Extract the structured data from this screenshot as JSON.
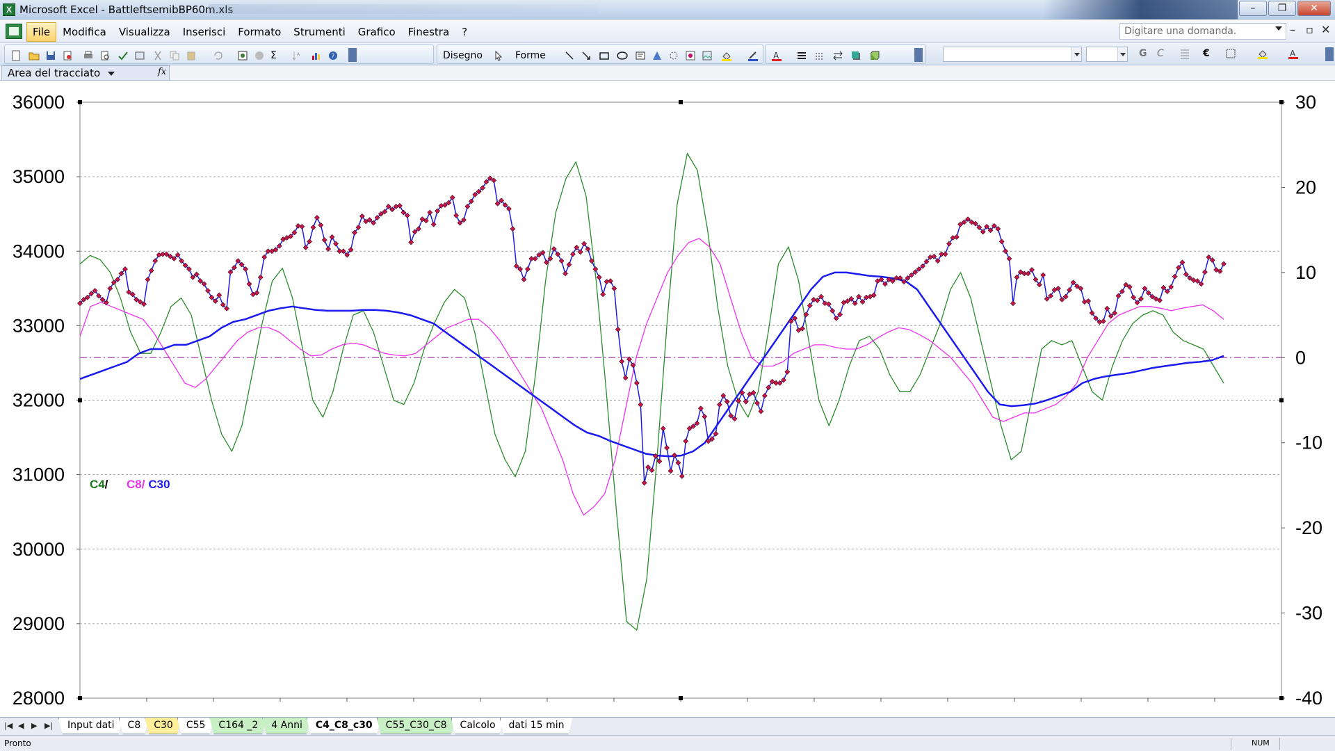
{
  "window": {
    "title": "Microsoft Excel - BattleftsemibBP60m.xls",
    "app_icon": "X"
  },
  "menu": {
    "items": [
      "File",
      "Modifica",
      "Visualizza",
      "Inserisci",
      "Formato",
      "Strumenti",
      "Grafico",
      "Finestra",
      "?"
    ],
    "active_index": 0,
    "question_placeholder": "Digitare una domanda."
  },
  "toolbar": {
    "drawing_label": "Disegno",
    "shapes_label": "Forme",
    "bold_label": "G",
    "italic_label": "C",
    "currency_label": "€",
    "sigma_label": "Σ"
  },
  "namebox": {
    "value": "Area del tracciato",
    "fx": "fx"
  },
  "chart_data": {
    "type": "line",
    "legend_text": [
      "C4",
      " / ",
      "C8/",
      " C30"
    ],
    "legend_colors": [
      "#1a7a1a",
      "#000000",
      "#e832e8",
      "#1c1ce6"
    ],
    "y_left": {
      "ticks": [
        36000,
        35000,
        34000,
        33000,
        32000,
        31000,
        30000,
        29000,
        28000
      ],
      "lim": [
        28000,
        36000
      ]
    },
    "y_right": {
      "ticks": [
        30,
        20,
        10,
        0,
        -10,
        -20,
        -30,
        -40
      ],
      "lim": [
        -40,
        30
      ]
    },
    "zero_line_color": "#b044b0",
    "series": [
      {
        "axis": "left",
        "color": "#1c1ce6",
        "marker": "diamond",
        "marker_color": "#c8164a",
        "values": [
          33300,
          33350,
          33380,
          33430,
          33470,
          33400,
          33350,
          33310,
          33500,
          33580,
          33620,
          33700,
          33760,
          33450,
          33420,
          33350,
          33320,
          33290,
          33620,
          33740,
          33870,
          33950,
          33960,
          33960,
          33930,
          33900,
          33950,
          33870,
          33810,
          33760,
          33650,
          33690,
          33600,
          33560,
          33470,
          33380,
          33330,
          33410,
          33280,
          33230,
          33720,
          33780,
          33870,
          33820,
          33760,
          33560,
          33420,
          33440,
          33650,
          33920,
          34000,
          34000,
          34020,
          34070,
          34160,
          34180,
          34200,
          34250,
          34340,
          34330,
          34050,
          34130,
          34320,
          34450,
          34350,
          34150,
          34030,
          34190,
          34100,
          34000,
          34000,
          33950,
          34020,
          34250,
          34320,
          34470,
          34400,
          34420,
          34380,
          34450,
          34500,
          34530,
          34600,
          34560,
          34600,
          34610,
          34520,
          34480,
          34120,
          34260,
          34300,
          34430,
          34410,
          34520,
          34360,
          34540,
          34610,
          34620,
          34650,
          34720,
          34480,
          34380,
          34420,
          34600,
          34670,
          34760,
          34800,
          34850,
          34930,
          34980,
          34950,
          34640,
          34680,
          34620,
          34570,
          34300,
          33800,
          33760,
          33620,
          33760,
          33900,
          33900,
          33950,
          33980,
          33850,
          33900,
          34030,
          33960,
          33870,
          33700,
          33820,
          33960,
          34050,
          33990,
          34100,
          34030,
          33870,
          33760,
          33650,
          33420,
          33590,
          33600,
          33500,
          32950,
          32520,
          32300,
          32550,
          32470,
          32230,
          31940,
          30890,
          31100,
          31060,
          31250,
          31180,
          31620,
          31360,
          31050,
          31260,
          31160,
          30980,
          31450,
          31620,
          31650,
          31690,
          31890,
          31780,
          31450,
          31480,
          31550,
          31940,
          32060,
          31980,
          31790,
          31750,
          31990,
          32100,
          31980,
          32080,
          32100,
          31960,
          31850,
          32060,
          32170,
          32250,
          32230,
          32230,
          32270,
          32380,
          33060,
          33100,
          32940,
          32960,
          33150,
          33270,
          33350,
          33340,
          33390,
          33300,
          33290,
          33200,
          33100,
          33150,
          33310,
          33330,
          33360,
          33300,
          33390,
          33320,
          33380,
          33390,
          33410,
          33600,
          33620,
          33560,
          33620,
          33600,
          33640,
          33640,
          33590,
          33640,
          33680,
          33720,
          33760,
          33800,
          33860,
          33920,
          33930,
          33870,
          33960,
          33960,
          34100,
          34180,
          34190,
          34360,
          34390,
          34430,
          34390,
          34370,
          34320,
          34260,
          34330,
          34280,
          34340,
          34300,
          34130,
          34000,
          33900,
          33300,
          33650,
          33720,
          33700,
          33700,
          33750,
          33620,
          33550,
          33680,
          33360,
          33400,
          33480,
          33500,
          33350,
          33390,
          33480,
          33580,
          33530,
          33500,
          33320,
          33330,
          33170,
          33100,
          33050,
          33060,
          33230,
          33130,
          33170,
          33400,
          33460,
          33550,
          33520,
          33380,
          33310,
          33360,
          33500,
          33440,
          33390,
          33360,
          33340,
          33510,
          33460,
          33520,
          33660,
          33780,
          33850,
          33690,
          33640,
          33610,
          33600,
          33560,
          33720,
          33920,
          33880,
          33750,
          33730,
          33830
        ]
      },
      {
        "axis": "right",
        "color": "#2a8c2a",
        "values": [
          11,
          12,
          11.5,
          10,
          7,
          3,
          0.5,
          0.5,
          3,
          6,
          7,
          5,
          0,
          -5,
          -9,
          -11,
          -8,
          -2,
          4,
          9,
          10.5,
          7,
          1,
          -5,
          -7,
          -4,
          1,
          5,
          5.5,
          3,
          -1,
          -5,
          -5.5,
          -3,
          1,
          4,
          6.5,
          8,
          7,
          3,
          -3,
          -9,
          -12,
          -14,
          -11,
          -2,
          9,
          17,
          21,
          23,
          19,
          9,
          -4,
          -18,
          -31,
          -32,
          -26,
          -12,
          4,
          18,
          24,
          22,
          15,
          6,
          -1,
          -5,
          -7,
          -4,
          3,
          11,
          13,
          9,
          2,
          -5,
          -8,
          -5,
          -1,
          2,
          2.5,
          1,
          -2,
          -4,
          -4,
          -2,
          1,
          4,
          8,
          10,
          7,
          2,
          -3,
          -8,
          -12,
          -11,
          -5,
          1,
          2,
          1.5,
          2,
          -1,
          -4,
          -5,
          -1,
          2,
          4,
          5,
          5.5,
          5,
          3,
          2,
          1.5,
          1,
          -1,
          -3
        ]
      },
      {
        "axis": "right",
        "color": "#ee33ee",
        "values": [
          2.5,
          6,
          6.5,
          6,
          5.5,
          5,
          4.5,
          3,
          1,
          -1,
          -3,
          -3.5,
          -2.5,
          -1,
          0.5,
          2,
          3,
          3.5,
          3.5,
          3,
          2,
          1,
          0.2,
          0.3,
          1,
          1.5,
          1.7,
          1.5,
          1,
          0.5,
          0.3,
          0.2,
          0.5,
          1.5,
          2.5,
          3.5,
          4,
          4.5,
          4.5,
          3.5,
          2,
          0,
          -2,
          -4,
          -6,
          -9,
          -12,
          -16,
          -18.5,
          -17.5,
          -16,
          -12,
          -6,
          0,
          4,
          7,
          10,
          12,
          13.5,
          14,
          13,
          11,
          7,
          3,
          0,
          -1,
          -1,
          -0.5,
          0.5,
          1,
          1.5,
          1.5,
          1.2,
          1,
          1,
          1.5,
          2.3,
          3,
          3.5,
          3.3,
          2.7,
          2,
          1,
          0,
          -1.5,
          -3,
          -5,
          -7,
          -7.5,
          -7,
          -6.5,
          -6.5,
          -6,
          -5.5,
          -4.5,
          -3,
          0,
          2,
          4,
          5,
          5.5,
          6,
          6,
          5.8,
          5.5,
          5.8,
          6,
          6.2,
          5.5,
          4.5
        ]
      },
      {
        "axis": "right",
        "color": "#1a1af0",
        "values": [
          -2.5,
          -2,
          -1.5,
          -1,
          -0.5,
          0.5,
          1,
          1,
          1.5,
          1.5,
          2,
          2.5,
          3.5,
          4.2,
          4.5,
          5,
          5.5,
          5.8,
          6,
          5.8,
          5.6,
          5.5,
          5.5,
          5.5,
          5.6,
          5.6,
          5.5,
          5.3,
          5,
          4.5,
          4,
          3,
          2,
          1,
          0,
          -1,
          -2,
          -3,
          -4,
          -5,
          -6,
          -7,
          -8,
          -8.8,
          -9.2,
          -9.8,
          -10.3,
          -10.8,
          -11.3,
          -11.5,
          -11.6,
          -11.5,
          -11,
          -10,
          -8,
          -6,
          -4,
          -2,
          0,
          2,
          4,
          6,
          8,
          9.5,
          10,
          10,
          9.8,
          9.6,
          9.5,
          9.3,
          9,
          8,
          6,
          4,
          2,
          0,
          -2,
          -4,
          -5.5,
          -5.7,
          -5.6,
          -5.4,
          -5,
          -4.5,
          -4,
          -3,
          -2.5,
          -2.2,
          -2,
          -1.8,
          -1.5,
          -1.2,
          -1,
          -0.8,
          -0.6,
          -0.5,
          -0.3,
          0.2
        ]
      }
    ]
  },
  "sheet_tabs": [
    {
      "label": "Input dati",
      "style": "white"
    },
    {
      "label": "C8",
      "style": "white"
    },
    {
      "label": "C30",
      "style": "yellow"
    },
    {
      "label": "C55",
      "style": "white"
    },
    {
      "label": "C164 _2",
      "style": "green"
    },
    {
      "label": "4 Anni",
      "style": "green"
    },
    {
      "label": "C4_C8_c30",
      "style": "active"
    },
    {
      "label": "C55_C30_C8",
      "style": "green"
    },
    {
      "label": "Calcolo",
      "style": "white"
    },
    {
      "label": "dati 15 min",
      "style": "white"
    }
  ],
  "status": {
    "left": "Pronto",
    "num": "NUM"
  }
}
